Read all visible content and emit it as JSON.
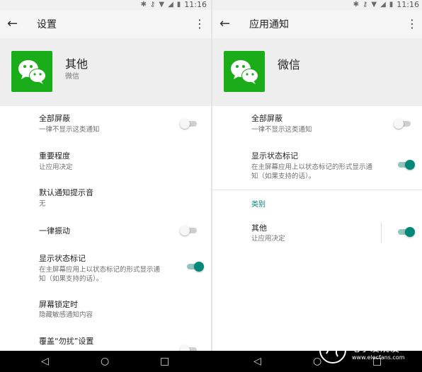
{
  "status": {
    "time": "11:16"
  },
  "left": {
    "toolbar": {
      "title": "设置"
    },
    "app": {
      "name": "其他",
      "sub": "微信"
    },
    "rows": [
      {
        "title": "全部屏蔽",
        "sub": "一律不显示这类通知",
        "toggle": "off"
      },
      {
        "title": "重要程度",
        "sub": "让应用决定"
      },
      {
        "title": "默认通知提示音",
        "sub": "无"
      },
      {
        "title": "一律振动",
        "toggle": "off"
      },
      {
        "title": "显示状态标记",
        "sub_line1": "在主屏幕应用上以状态标记的形式显示通",
        "sub_line2": "知（如果支持的话）。",
        "toggle": "on"
      },
      {
        "title": "屏幕锁定时",
        "sub": "隐藏敏感通知内容"
      },
      {
        "title": "覆盖“勿扰”设置"
      }
    ]
  },
  "right": {
    "toolbar": {
      "title": "应用通知"
    },
    "app": {
      "name": "微信"
    },
    "rows": [
      {
        "title": "全部屏蔽",
        "sub": "一律不显示这类通知",
        "toggle": "off"
      },
      {
        "title": "显示状态标记",
        "sub_line1": "在主屏幕应用上以状态标记的形式显示通",
        "sub_line2": "知（如果支持的话）。",
        "toggle": "on"
      }
    ],
    "section": "类别",
    "category": {
      "title": "其他",
      "sub": "让应用决定",
      "toggle": "on"
    }
  },
  "watermark": {
    "text": "电子发烧友",
    "url": "www.elecfans.com"
  },
  "colors": {
    "accent": "#00897b",
    "wechat": "#1aad19",
    "header_bg": "#eeeeee"
  }
}
